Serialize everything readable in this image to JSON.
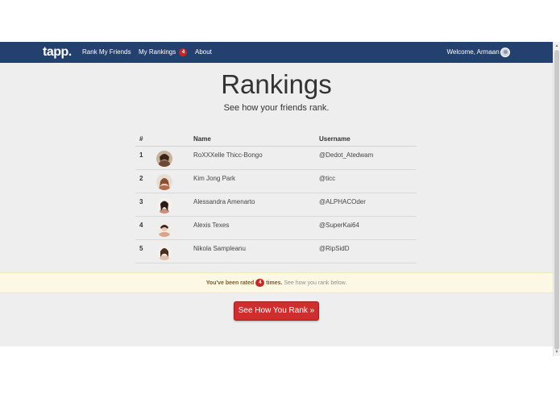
{
  "nav": {
    "brand": "tapp.",
    "links": [
      {
        "label": "Rank My Friends"
      },
      {
        "label": "My Rankings",
        "badge": "4"
      },
      {
        "label": "About"
      }
    ],
    "welcome": "Welcome, Armaan |"
  },
  "page": {
    "title": "Rankings",
    "subtitle": "See how your friends rank."
  },
  "table": {
    "headers": {
      "num": "#",
      "name": "Name",
      "username": "Username"
    },
    "rows": [
      {
        "num": "1",
        "name": "RoXXXelle Thicc-Bongo",
        "username": "@Dedot_Atedwam"
      },
      {
        "num": "2",
        "name": "Kim Jong Park",
        "username": "@ticc"
      },
      {
        "num": "3",
        "name": "Alessandra Amenarto",
        "username": "@ALPHACOder"
      },
      {
        "num": "4",
        "name": "Alexis Texes",
        "username": "@SuperKai64"
      },
      {
        "num": "5",
        "name": "Nikola Sampleanu",
        "username": "@RipSidD"
      }
    ]
  },
  "alert": {
    "prefix": "You've been rated",
    "count": "4",
    "suffix": "times.",
    "tail": "See how you rank below."
  },
  "cta": {
    "label": "See How You Rank »"
  },
  "colors": {
    "navbar": "#23406f",
    "badge": "#c62828",
    "cta": "#cf2e2e",
    "alert_bg": "#fcf8e3"
  },
  "icons": [
    "user-avatar-icon",
    "friend-avatar-photo",
    "scroll-up-arrow-icon",
    "scroll-down-arrow-icon"
  ]
}
